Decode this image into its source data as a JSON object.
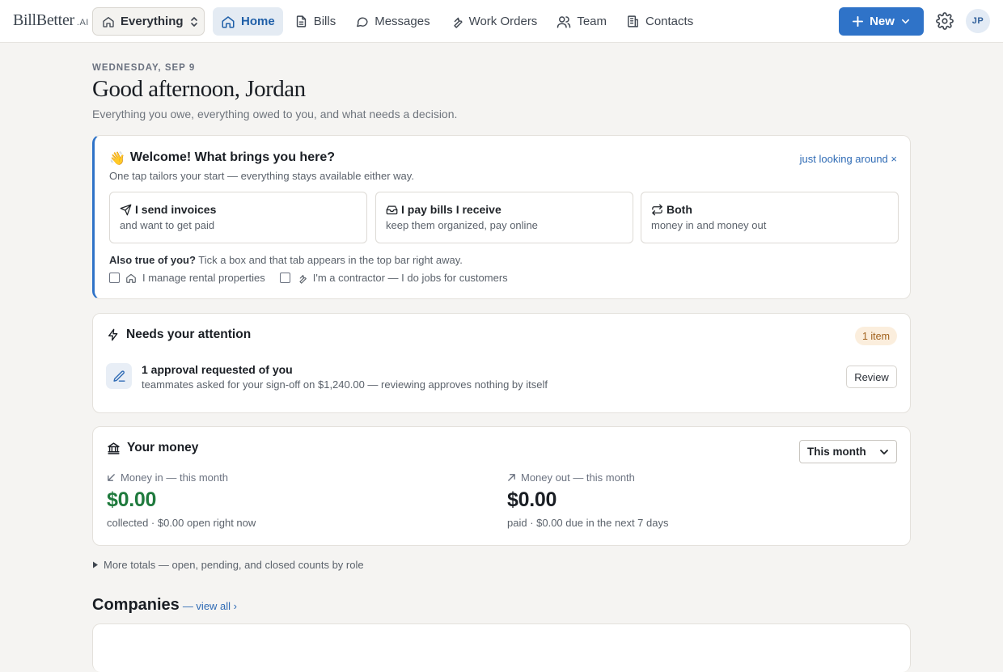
{
  "app": {
    "logo_main": "BillBetter",
    "logo_suffix": ".AI"
  },
  "scope": {
    "label": "Everything"
  },
  "nav": [
    {
      "label": "Home",
      "icon": "home-icon",
      "active": true
    },
    {
      "label": "Bills",
      "icon": "document-icon"
    },
    {
      "label": "Messages",
      "icon": "chat-bubble-icon"
    },
    {
      "label": "Work Orders",
      "icon": "wrench-icon"
    },
    {
      "label": "Team",
      "icon": "users-icon"
    },
    {
      "label": "Contacts",
      "icon": "building-icon"
    }
  ],
  "header_actions": {
    "new_label": "New",
    "avatar_initials": "JP"
  },
  "greeting": {
    "date": "WEDNESDAY, SEP 9",
    "title": "Good afternoon, Jordan",
    "subtitle": "Everything you owe, everything owed to you, and what needs a decision."
  },
  "welcome": {
    "emoji": "👋",
    "title": "Welcome! What brings you here?",
    "dismiss": "just looking around ×",
    "desc": "One tap tailors your start — everything stays available either way.",
    "choices": [
      {
        "title": "I send invoices",
        "sub": "and want to get paid",
        "icon": "send-icon"
      },
      {
        "title": "I pay bills I receive",
        "sub": "keep them organized, pay online",
        "icon": "inbox-icon"
      },
      {
        "title": "Both",
        "sub": "money in and money out",
        "icon": "swap-icon"
      }
    ],
    "also_bold": "Also true of you?",
    "also_text": " Tick a box and that tab appears in the top bar right away.",
    "checks": [
      {
        "label": "I manage rental properties",
        "icon": "home-icon"
      },
      {
        "label": "I'm a contractor — I do jobs for customers",
        "icon": "wrench-icon"
      }
    ]
  },
  "attention": {
    "title": "Needs your attention",
    "count": "1 item",
    "item_title": "1 approval requested of you",
    "item_sub": "teammates asked for your sign-off on $1,240.00 — reviewing approves nothing by itself",
    "action": "Review"
  },
  "money": {
    "title": "Your money",
    "period": "This month",
    "in_label": "Money in — this month",
    "in_amount": "$0.00",
    "in_foot": "collected · $0.00 open right now",
    "out_label": "Money out — this month",
    "out_amount": "$0.00",
    "out_foot": "paid · $0.00 due in the next 7 days"
  },
  "more_totals": "More totals — open, pending, and closed counts by role",
  "companies": {
    "title": "Companies",
    "view_all": "— view all ›"
  },
  "colors": {
    "accent": "#2f73c8",
    "positive": "#1f7a3d",
    "badge_bg": "#fbeedd"
  }
}
